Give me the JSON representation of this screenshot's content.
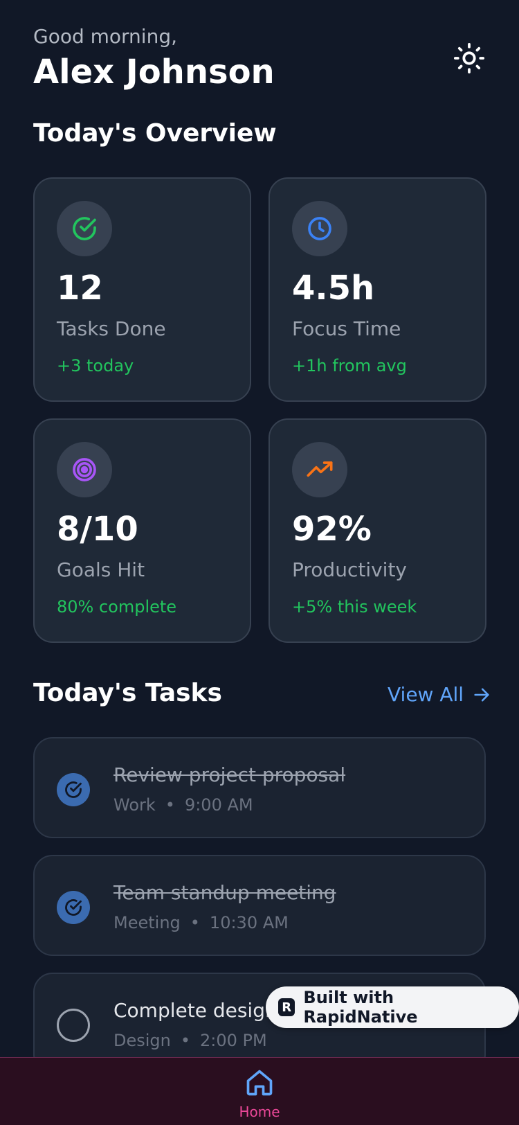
{
  "header": {
    "greeting": "Good morning,",
    "name": "Alex Johnson",
    "theme_icon": "sun-icon"
  },
  "overview": {
    "title": "Today's Overview",
    "stats": [
      {
        "icon": "check-circle-icon",
        "icon_color": "#22c55e",
        "value": "12",
        "label": "Tasks Done",
        "delta": "+3 today"
      },
      {
        "icon": "clock-icon",
        "icon_color": "#3b82f6",
        "value": "4.5h",
        "label": "Focus Time",
        "delta": "+1h from avg"
      },
      {
        "icon": "target-icon",
        "icon_color": "#a855f7",
        "value": "8/10",
        "label": "Goals Hit",
        "delta": "80% complete"
      },
      {
        "icon": "trending-up-icon",
        "icon_color": "#f97316",
        "value": "92%",
        "label": "Productivity",
        "delta": "+5% this week"
      }
    ]
  },
  "tasks": {
    "title": "Today's Tasks",
    "view_all": "View All",
    "separator": "•",
    "items": [
      {
        "title": "Review project proposal",
        "category": "Work",
        "time": "9:00 AM",
        "done": true
      },
      {
        "title": "Team standup meeting",
        "category": "Meeting",
        "time": "10:30 AM",
        "done": true
      },
      {
        "title": "Complete design",
        "category": "Design",
        "time": "2:00 PM",
        "done": false
      }
    ]
  },
  "badge": {
    "logo": "R",
    "label": "Built with RapidNative"
  },
  "tabbar": {
    "home_label": "Home"
  },
  "colors": {
    "background": "#111827",
    "card": "#1f2937",
    "accent_blue": "#60a5fa",
    "positive": "#22c55e",
    "tab_active": "#ec4899"
  }
}
